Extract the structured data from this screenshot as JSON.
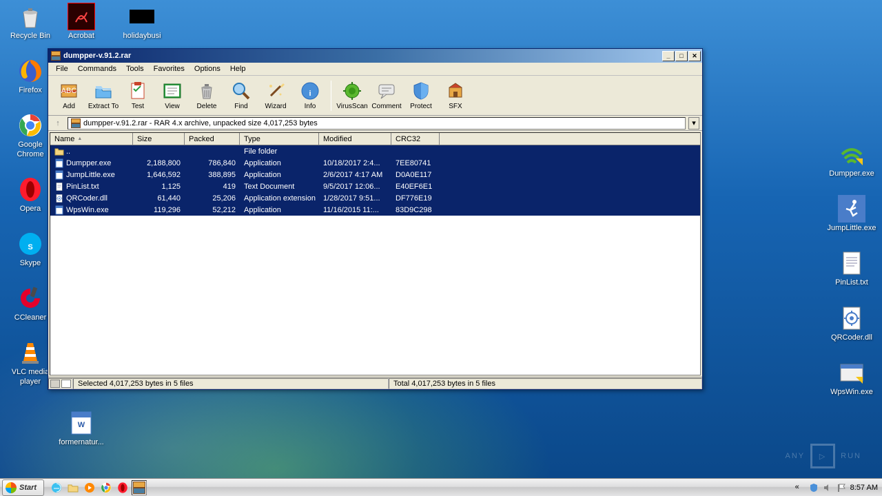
{
  "desktop": {
    "left": [
      {
        "label": "Recycle Bin",
        "icon": "recycle"
      },
      {
        "label": "Firefox",
        "icon": "firefox"
      },
      {
        "label": "Google Chrome",
        "icon": "chrome"
      },
      {
        "label": "Opera",
        "icon": "opera"
      },
      {
        "label": "Skype",
        "icon": "skype"
      },
      {
        "label": "CCleaner",
        "icon": "ccleaner"
      },
      {
        "label": "VLC media player",
        "icon": "vlc"
      }
    ],
    "top": [
      {
        "label": "Acrobat",
        "icon": "acrobat"
      },
      {
        "label": "holidaybusi",
        "icon": "black"
      }
    ],
    "left_bottom": [
      {
        "label": "formernatur...",
        "icon": "doc"
      }
    ],
    "right": [
      {
        "label": "Dumpper.exe",
        "icon": "wifi"
      },
      {
        "label": "JumpLittle.exe",
        "icon": "jump"
      },
      {
        "label": "PinList.txt",
        "icon": "txt"
      },
      {
        "label": "QRCoder.dll",
        "icon": "dll"
      },
      {
        "label": "WpsWin.exe",
        "icon": "wps"
      }
    ]
  },
  "winrar": {
    "title": "dumpper-v.91.2.rar",
    "menu": [
      "File",
      "Commands",
      "Tools",
      "Favorites",
      "Options",
      "Help"
    ],
    "toolbar": [
      {
        "label": "Add",
        "icon": "add"
      },
      {
        "label": "Extract To",
        "icon": "extract"
      },
      {
        "label": "Test",
        "icon": "test"
      },
      {
        "label": "View",
        "icon": "view"
      },
      {
        "label": "Delete",
        "icon": "delete"
      },
      {
        "label": "Find",
        "icon": "find"
      },
      {
        "label": "Wizard",
        "icon": "wizard"
      },
      {
        "label": "Info",
        "icon": "info"
      },
      {
        "label": "VirusScan",
        "icon": "virus"
      },
      {
        "label": "Comment",
        "icon": "comment"
      },
      {
        "label": "Protect",
        "icon": "protect"
      },
      {
        "label": "SFX",
        "icon": "sfx"
      }
    ],
    "toolbar_sep_after": 7,
    "path": "dumpper-v.91.2.rar - RAR 4.x archive, unpacked size 4,017,253 bytes",
    "columns": [
      "Name",
      "Size",
      "Packed",
      "Type",
      "Modified",
      "CRC32"
    ],
    "rows": [
      {
        "name": "..",
        "size": "",
        "packed": "",
        "type": "File folder",
        "modified": "",
        "crc": "",
        "icon": "folder"
      },
      {
        "name": "Dumpper.exe",
        "size": "2,188,800",
        "packed": "786,840",
        "type": "Application",
        "modified": "10/18/2017 2:4...",
        "crc": "7EE80741",
        "icon": "exe"
      },
      {
        "name": "JumpLittle.exe",
        "size": "1,646,592",
        "packed": "388,895",
        "type": "Application",
        "modified": "2/6/2017 4:17 AM",
        "crc": "D0A0E117",
        "icon": "exe"
      },
      {
        "name": "PinList.txt",
        "size": "1,125",
        "packed": "419",
        "type": "Text Document",
        "modified": "9/5/2017 12:06...",
        "crc": "E40EF6E1",
        "icon": "txt"
      },
      {
        "name": "QRCoder.dll",
        "size": "61,440",
        "packed": "25,206",
        "type": "Application extension",
        "modified": "1/28/2017 9:51...",
        "crc": "DF776E19",
        "icon": "dll"
      },
      {
        "name": "WpsWin.exe",
        "size": "119,296",
        "packed": "52,212",
        "type": "Application",
        "modified": "11/16/2015 11:...",
        "crc": "83D9C298",
        "icon": "exe"
      }
    ],
    "status_left": "Selected 4,017,253 bytes in 5 files",
    "status_right": "Total 4,017,253 bytes in 5 files"
  },
  "taskbar": {
    "start": "Start",
    "items": [
      "ie",
      "explorer",
      "wmp",
      "chrome",
      "opera",
      "winrar"
    ],
    "active_item": 5,
    "clock": "8:57 AM"
  },
  "watermark": {
    "text1": "ANY",
    "text2": "RUN"
  }
}
